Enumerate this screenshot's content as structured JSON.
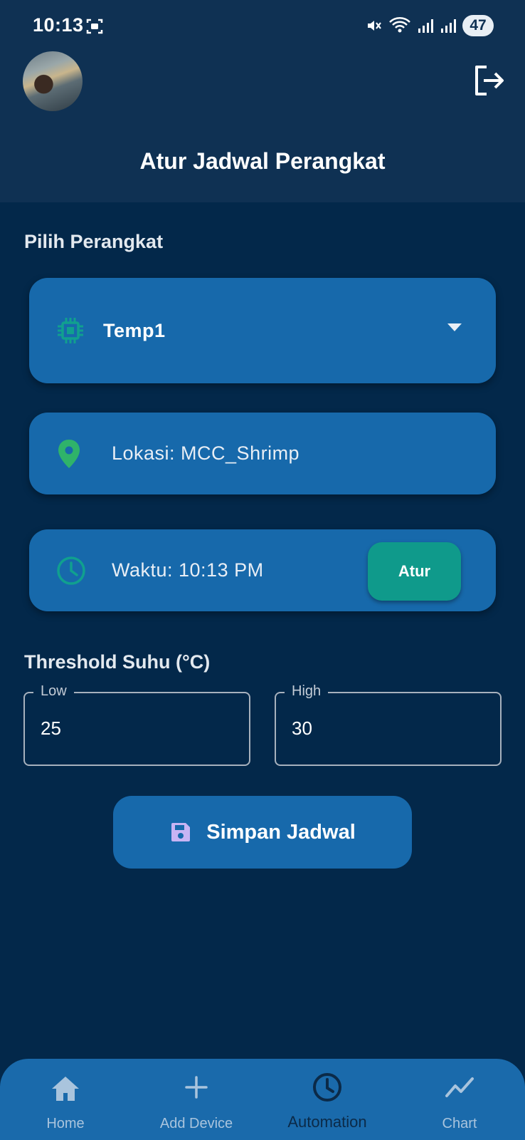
{
  "status_bar": {
    "time": "10:13",
    "battery": "47"
  },
  "header": {
    "title": "Atur Jadwal Perangkat"
  },
  "device_section": {
    "title": "Pilih Perangkat",
    "selected_device": "Temp1",
    "location_text": "Lokasi: MCC_Shrimp",
    "time_text": "Waktu: 10:13 PM",
    "set_time_label": "Atur"
  },
  "threshold_section": {
    "title": "Threshold Suhu (°C)",
    "low_label": "Low",
    "low_value": "25",
    "high_label": "High",
    "high_value": "30"
  },
  "save_button": {
    "label": "Simpan Jadwal"
  },
  "bottom_nav": {
    "items": [
      {
        "label": "Home",
        "icon": "home-icon"
      },
      {
        "label": "Add Device",
        "icon": "plus-icon"
      },
      {
        "label": "Automation",
        "icon": "clock-icon",
        "active": true
      },
      {
        "label": "Chart",
        "icon": "chart-line-icon"
      }
    ]
  },
  "colors": {
    "background": "#03284a",
    "header": "#0f3153",
    "card": "#1769ab",
    "accent_teal": "#0f9a8b",
    "location_pin": "#2fb36a"
  }
}
